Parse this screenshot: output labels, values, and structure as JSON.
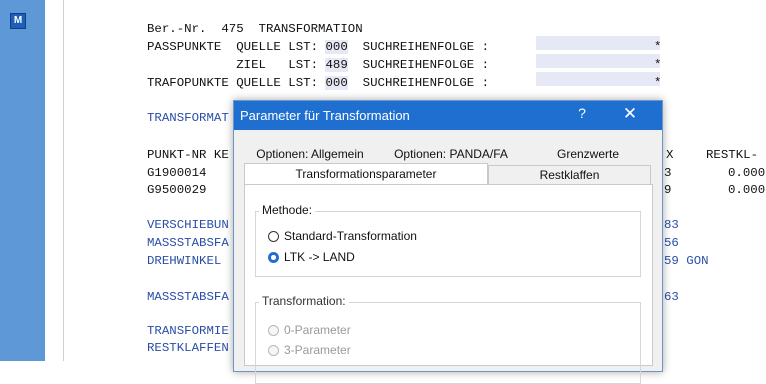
{
  "window": {
    "side_button_label": "M"
  },
  "document": {
    "line1": "Ber.-Nr.  475  TRANSFORMATION",
    "passpunkte_quelle": "PASSPUNKTE  QUELLE LST: ",
    "passpunkte_quelle_value": "000",
    "passpunkte_suchreihenfolge": "  SUCHREIHENFOLGE :",
    "passpunkte_star": "*",
    "ziel": "            ZIEL   LST: ",
    "ziel_value": "489",
    "ziel_suchreihenfolge": "  SUCHREIHENFOLGE :",
    "ziel_star": "*",
    "trafo_quelle": "TRAFOPUNKTE QUELLE LST: ",
    "trafo_quelle_value": "000",
    "trafo_suchreihenfolge": "  SUCHREIHENFOLGE :",
    "trafo_star": "*",
    "transformat": "TRANSFORMAT",
    "punkt_nr": "PUNKT-NR KE",
    "row1_id": "G1900014",
    "row2_id": "G9500029",
    "verschiebu": "VERSCHIEBUN",
    "massstabsfa1": "MASSSTABSFA",
    "drehwinkel": "DREHWINKEL",
    "massstabsfa2": "MASSSTABSFA",
    "transformie": "TRANSFORMIE",
    "restklaffen": "RESTKLAFFEN",
    "col_x_header": "X",
    "restkl_header": "RESTKL-",
    "row1_x": "3",
    "row2_x": "9",
    "row1_rest": "0.000",
    "row2_rest": "0.000",
    "verschiebu_val": "83",
    "massstabsfa1_val": "56",
    "drehwinkel_val": "59 GON",
    "massstabsfa2_val": "63"
  },
  "dialog": {
    "title": "Parameter für Transformation",
    "help_icon_label": "?",
    "close_icon_label": "✕",
    "tabs_row1": [
      {
        "label": "Optionen: Allgemein"
      },
      {
        "label": "Optionen: PANDA/FA"
      },
      {
        "label": "Grenzwerte"
      }
    ],
    "tabs_row2": [
      {
        "label": "Transformationsparameter",
        "active": true
      },
      {
        "label": "Restklaffen",
        "active": false
      }
    ],
    "methode": {
      "legend": "Methode:",
      "options": [
        {
          "label": "Standard-Transformation",
          "checked": false
        },
        {
          "label": "LTK -> LAND",
          "checked": true
        }
      ]
    },
    "transformation": {
      "legend": "Transformation:",
      "options": [
        {
          "label": "0-Parameter",
          "enabled": false
        },
        {
          "label": "3-Parameter",
          "enabled": false
        }
      ]
    }
  },
  "colors": {
    "titlebar": "#1f6fd1",
    "leftbar": "#5e98d6",
    "blue_text": "#2a4ea8",
    "highlight": "#e6e8f5"
  }
}
